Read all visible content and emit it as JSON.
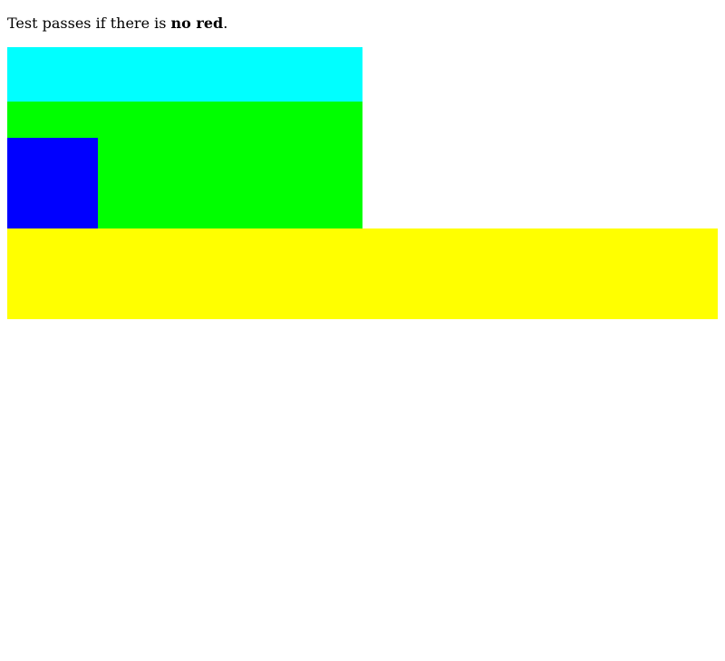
{
  "instruction": {
    "prefix": "Test passes if there is ",
    "emphasis": "no red",
    "suffix": "."
  },
  "colors": {
    "cyan": "#00ffff",
    "green": "#00ff00",
    "blue": "#0000ff",
    "yellow": "#ffff00"
  }
}
